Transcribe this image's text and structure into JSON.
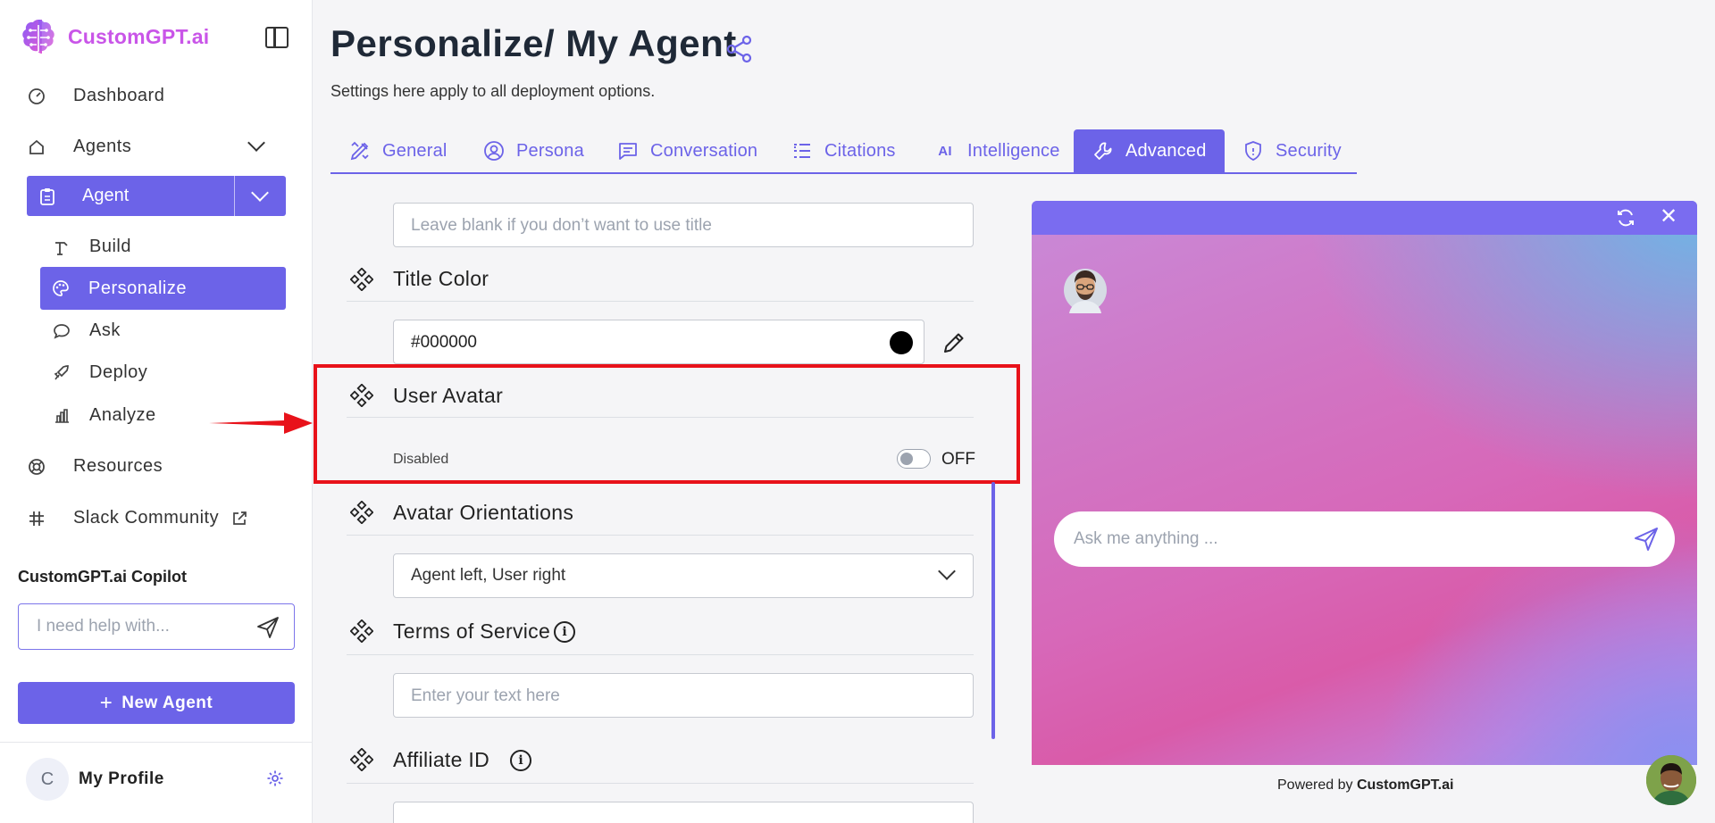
{
  "brand": {
    "name": "CustomGPT.ai"
  },
  "sidebar": {
    "nav": [
      {
        "label": "Dashboard",
        "icon": "dashboard-icon"
      },
      {
        "label": "Agents",
        "icon": "home-icon"
      },
      {
        "label": "Agent",
        "icon": "clipboard-icon"
      }
    ],
    "sub_items": [
      {
        "label": "Build",
        "icon": "build-icon"
      },
      {
        "label": "Personalize",
        "icon": "palette-icon"
      },
      {
        "label": "Ask",
        "icon": "chat-icon"
      },
      {
        "label": "Deploy",
        "icon": "rocket-icon"
      },
      {
        "label": "Analyze",
        "icon": "bar-chart-icon"
      }
    ],
    "resources": "Resources",
    "slack": "Slack Community",
    "copilot_title": "CustomGPT.ai Copilot",
    "copilot_placeholder": "I need help with...",
    "new_agent": "New Agent",
    "profile_initial": "C",
    "profile_name": "My Profile"
  },
  "main": {
    "title": "Personalize/ My Agent",
    "subtitle": "Settings here apply to all deployment options.",
    "tabs": [
      {
        "label": "General",
        "icon": "pen-ruler-icon"
      },
      {
        "label": "Persona",
        "icon": "user-circle-icon"
      },
      {
        "label": "Conversation",
        "icon": "message-icon"
      },
      {
        "label": "Citations",
        "icon": "quote-list-icon"
      },
      {
        "label": "Intelligence",
        "icon": "ai-icon"
      },
      {
        "label": "Advanced",
        "icon": "wrench-icon"
      },
      {
        "label": "Security",
        "icon": "shield-icon"
      }
    ],
    "active_tab": "Advanced",
    "title_input_placeholder": "Leave blank if you don’t want to use title",
    "title_color": {
      "label": "Title Color",
      "value": "#000000"
    },
    "user_avatar": {
      "label": "User Avatar",
      "status": "Disabled",
      "toggle_text": "OFF"
    },
    "avatar_orientations": {
      "label": "Avatar Orientations",
      "selected": "Agent left, User right"
    },
    "terms": {
      "label": "Terms of Service",
      "placeholder": "Enter your text here"
    },
    "affiliate": {
      "label": "Affiliate ID"
    }
  },
  "preview": {
    "ask_placeholder": "Ask me anything ...",
    "powered_prefix": "Powered by",
    "powered_brand": "CustomGPT.ai"
  },
  "colors": {
    "accent": "#6c63e8",
    "highlight": "#e8121a",
    "preview_header": "#7a6cf0"
  }
}
